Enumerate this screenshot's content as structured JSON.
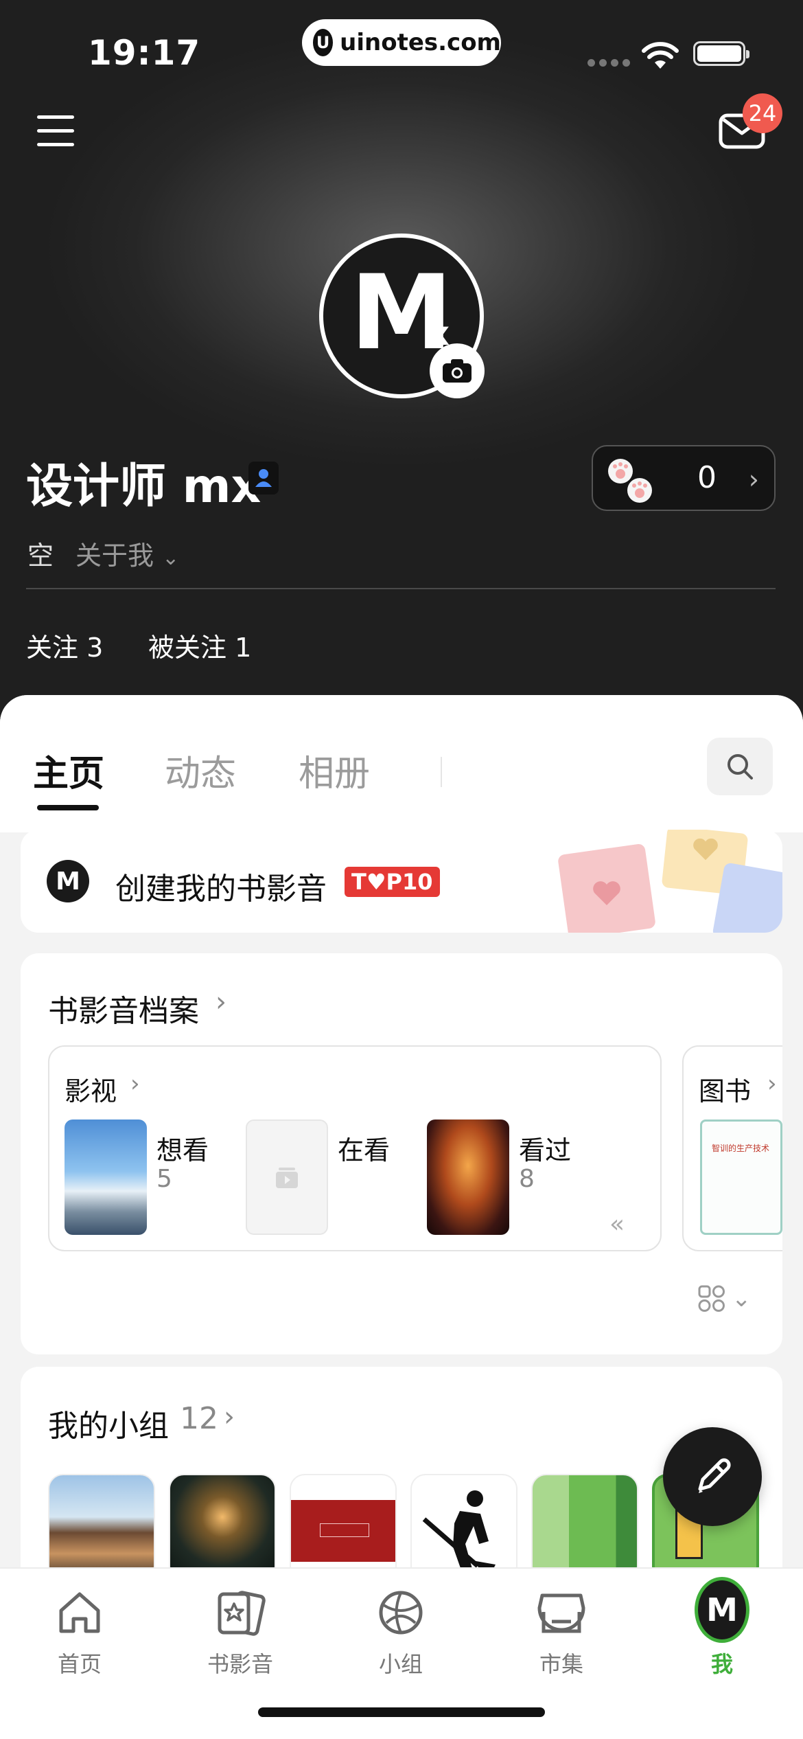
{
  "status_bar": {
    "time": "19:17",
    "url": "uinotes.com",
    "url_logo": "U"
  },
  "header": {
    "mail_badge": "24",
    "avatar_text": "M",
    "avatar_sub": "x",
    "user_name": "设计师 mx",
    "paw_count": "0",
    "bio_empty": "空",
    "about_me": "关于我",
    "following": "关注 3",
    "followers": "被关注 1"
  },
  "tabs": {
    "home": "主页",
    "activity": "动态",
    "album": "相册"
  },
  "top10": {
    "text": "创建我的书影音",
    "tag": "T♥P10",
    "logo": "M"
  },
  "archive": {
    "title": "书影音档案",
    "movie": {
      "label": "影视",
      "items": [
        {
          "label": "想看",
          "count": "5"
        },
        {
          "label": "在看",
          "count": ""
        },
        {
          "label": "看过",
          "count": "8"
        }
      ]
    },
    "book": {
      "label": "图书",
      "cover_title": "智训的生产技术"
    }
  },
  "groups": {
    "title": "我的小组",
    "count": "12"
  },
  "nav": {
    "home": "首页",
    "books": "书影音",
    "groups": "小组",
    "market": "市集",
    "me": "我",
    "me_avatar": "M"
  },
  "colors": {
    "accent_green": "#3fae3a",
    "badge_red": "#f05a4f",
    "top10_red": "#e53935"
  }
}
